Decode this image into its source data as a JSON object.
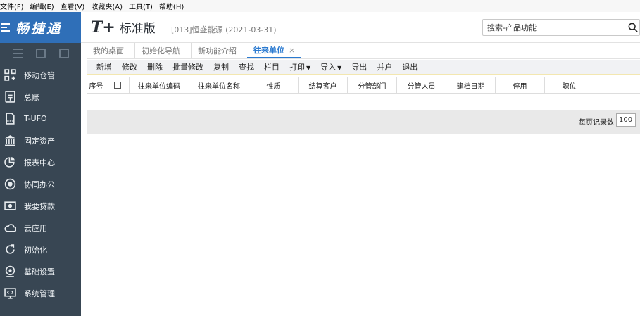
{
  "menu": [
    "文件(F)",
    "编辑(E)",
    "查看(V)",
    "收藏夹(A)",
    "工具(T)",
    "帮助(H)"
  ],
  "brand": {
    "name": "畅捷通"
  },
  "sidebar": {
    "items": [
      {
        "label": "移动仓管",
        "icon": "mobile-warehouse-icon"
      },
      {
        "label": "总账",
        "icon": "ledger-icon"
      },
      {
        "label": "T-UFO",
        "icon": "ufo-icon"
      },
      {
        "label": "固定资产",
        "icon": "bank-icon"
      },
      {
        "label": "报表中心",
        "icon": "pie-chart-icon"
      },
      {
        "label": "协同办公",
        "icon": "collaboration-icon"
      },
      {
        "label": "我要贷款",
        "icon": "money-icon"
      },
      {
        "label": "云应用",
        "icon": "cloud-icon"
      },
      {
        "label": "初始化",
        "icon": "refresh-icon"
      },
      {
        "label": "基础设置",
        "icon": "settings-icon"
      },
      {
        "label": "系统管理",
        "icon": "monitor-code-icon"
      }
    ]
  },
  "header": {
    "logo_mark": "T+",
    "edition": "标准版",
    "company": "[013]恒盛能源   (2021-03-31)",
    "search_placeholder": "搜索-产品功能"
  },
  "tabs": [
    {
      "label": "我的桌面",
      "active": false
    },
    {
      "label": "初始化导航",
      "active": false
    },
    {
      "label": "新功能介绍",
      "active": false
    },
    {
      "label": "往来单位",
      "active": true,
      "close": "×"
    }
  ],
  "toolbar": [
    {
      "label": "新增"
    },
    {
      "label": "修改"
    },
    {
      "label": "删除"
    },
    {
      "label": "批量修改"
    },
    {
      "label": "复制"
    },
    {
      "label": "查找"
    },
    {
      "label": "栏目"
    },
    {
      "label": "打印",
      "dropdown": true
    },
    {
      "label": "导入",
      "dropdown": true
    },
    {
      "label": "导出"
    },
    {
      "label": "并户"
    },
    {
      "label": "退出"
    }
  ],
  "grid": {
    "columns": [
      "序号",
      "",
      "往来单位编码",
      "往来单位名称",
      "性质",
      "结算客户",
      "分管部门",
      "分管人员",
      "建档日期",
      "停用",
      "职位"
    ]
  },
  "pager": {
    "label": "每页记录数",
    "value": "100"
  }
}
